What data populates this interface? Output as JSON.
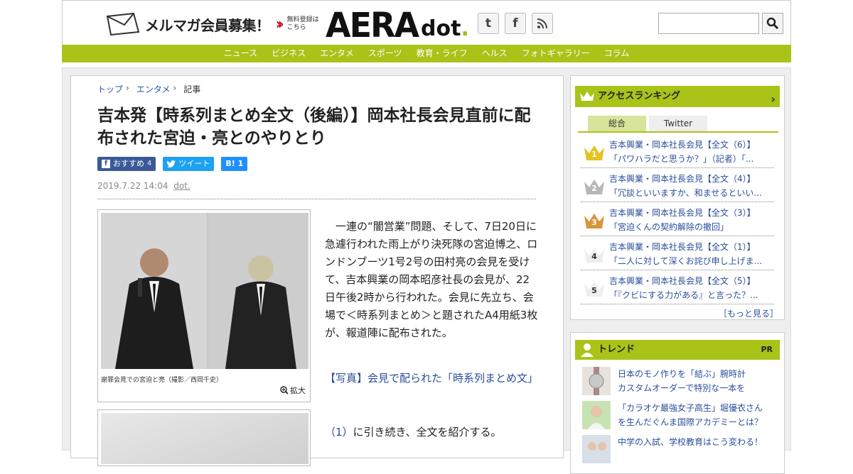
{
  "header": {
    "mailmag_label": "メルマガ会員募集！",
    "mailmag_sub1": "無料登録は",
    "mailmag_sub2": "こちら",
    "logo_main": "AERA",
    "logo_sub": "dot",
    "logo_period": ".",
    "social_twitter": "t",
    "social_facebook": "f",
    "search_placeholder": ""
  },
  "nav": {
    "items": [
      "ニュース",
      "ビジネス",
      "エンタメ",
      "スポーツ",
      "教育・ライフ",
      "ヘルス",
      "フォトギャラリー",
      "コラム"
    ]
  },
  "article": {
    "breadcrumb": [
      "トップ",
      "エンタメ",
      "記事"
    ],
    "title": "吉本発【時系列まとめ全文（後編）】岡本社長会見直前に配布された宮迫・亮とのやりとり",
    "share_fb": "おすすめ",
    "share_fb_count": "4",
    "share_tw": "ツイート",
    "share_hb": "B! 1",
    "date": "2019.7.22 14:04",
    "source": "dot.",
    "photo_caption": "謝罪会見での宮迫と亮（撮影／西岡千史）",
    "zoom_label": "拡大",
    "body": "　一連の“闇営業”問題、そして、7日20日に急遽行われた雨上がり決死隊の宮迫博之、ロンドンブーツ1号2号の田村亮の会見を受けて、吉本興業の岡本昭彦社長の会見が、22日午後2時から行われた。会見に先立ち、会場で＜時系列まとめ＞と題されたA4用紙3枚が、報道陣に配布された。",
    "photo_link": "【写真】会見で配られた「時系列まとめ文」",
    "body2_link": "（1）",
    "body2": "に引き続き、全文を紹介する。"
  },
  "ranking": {
    "title": "アクセスランキング",
    "tabs": [
      "総合",
      "Twitter"
    ],
    "items": [
      {
        "rank": "1",
        "line1": "吉本興業・岡本社長会見【全文（6）】",
        "line2": "「パワハラだと思うか？」（記者）「..."
      },
      {
        "rank": "2",
        "line1": "吉本興業・岡本社長会見【全文（4）】",
        "line2": "「冗談といいますか、和ませるといい..."
      },
      {
        "rank": "3",
        "line1": "吉本興業・岡本社長会見【全文（3）】",
        "line2": "「宮迫くんの契約解除の撤回」"
      },
      {
        "rank": "4",
        "line1": "吉本興業・岡本社長会見【全文（1）】",
        "line2": "「二人に対して深くお詫び申し上げま..."
      },
      {
        "rank": "5",
        "line1": "吉本興業・岡本社長会見【全文（5）】",
        "line2": "「『クビにする力がある』と言った？..."
      }
    ],
    "more": "［もっと見る］"
  },
  "trend": {
    "title": "トレンド",
    "pr": "PR",
    "items": [
      {
        "line1": "日本のモノ作りを「結ぶ」腕時計",
        "line2": "カスタムオーダーで特別な一本を"
      },
      {
        "line1": "「カラオケ最強女子高生」堀優衣さん",
        "line2": "を生んだぐんま国際アカデミーとは？"
      },
      {
        "line1": "中学の入試、学校教育はこう変わる！",
        "line2": ""
      }
    ]
  },
  "colors": {
    "accent_green": "#a9c319",
    "link_blue": "#2a4d9b",
    "gold": "#e6c31e",
    "silver": "#b7b7b7",
    "bronze": "#d9963d"
  }
}
